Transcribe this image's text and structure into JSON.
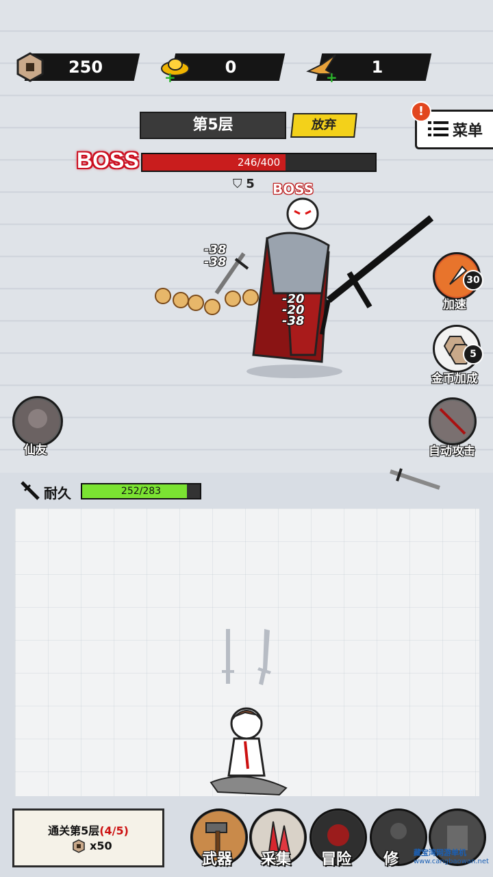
{
  "resources": {
    "coins": {
      "value": "250",
      "icon": "copper-coin-icon"
    },
    "gold": {
      "value": "0",
      "icon": "gold-ingot-icon"
    },
    "crane": {
      "value": "1",
      "icon": "paper-crane-icon"
    }
  },
  "floor": {
    "label": "第5层",
    "abandon": "放弃"
  },
  "menu": {
    "label": "菜单",
    "badge": "!"
  },
  "boss": {
    "label": "BOSS",
    "hp_text": "246/400",
    "hp_current": 246,
    "hp_max": 400,
    "tag": "BOSS",
    "shield": "5"
  },
  "damage_numbers": [
    "-38",
    "-38",
    "-20",
    "-20",
    "-38"
  ],
  "side": {
    "speedup": {
      "label": "加速",
      "badge": "30"
    },
    "coin_bonus": {
      "label": "金币加成",
      "badge": "5"
    },
    "auto_attack": {
      "label": "自动攻击"
    },
    "companion": {
      "label": "仙友"
    }
  },
  "durability": {
    "label": "耐久",
    "text": "252/283",
    "current": 252,
    "max": 283
  },
  "quest": {
    "prefix": "通关第5层",
    "progress": "(4/5)",
    "reward": "x50"
  },
  "nav": [
    {
      "label": "武器"
    },
    {
      "label": "采集"
    },
    {
      "label": "冒险"
    },
    {
      "label": "修"
    },
    {
      "label": ""
    }
  ],
  "watermark": {
    "line1": "藏宝湾网游单机",
    "line2": "www.cangbaowan.net"
  },
  "colors": {
    "hp_red": "#c91d1d",
    "durability_green": "#7be332",
    "abandon_yellow": "#f3d11a"
  }
}
